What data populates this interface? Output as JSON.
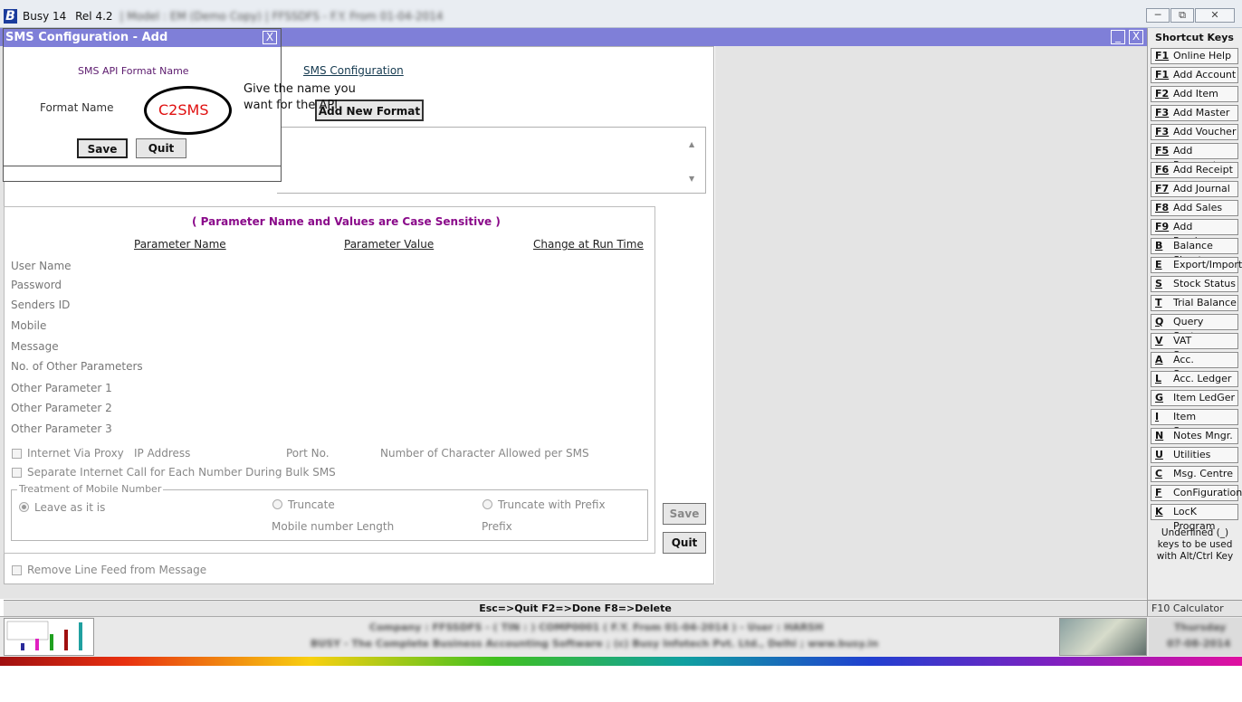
{
  "titlebar": {
    "logo": "B",
    "app_name": "Busy 14",
    "release": "Rel 4.2",
    "model_info": "| Model : EM (Demo Copy) | FFSSDFS - F.Y. From 01-04-2014"
  },
  "window_buttons": {
    "minimize": "─",
    "restore": "⧉",
    "close": "✕"
  },
  "mdi_buttons": {
    "minimize": "_",
    "close": "X"
  },
  "main": {
    "title": "SMS Configuration",
    "add_new_format_label": "Add New Format",
    "case_note": "( Parameter Name and Values are Case Sensitive )",
    "columns": [
      "Parameter Name",
      "Parameter Value",
      "Change at Run Time"
    ],
    "parameters": [
      "User Name",
      "Password",
      "Senders ID",
      "Mobile",
      "Message",
      "No. of Other Parameters",
      "Other Parameter 1",
      "Other Parameter 2",
      "Other Parameter 3"
    ],
    "internet_via_proxy": "Internet Via Proxy",
    "ip_address": "IP Address",
    "port_no": "Port No.",
    "chars_per_sms": "Number of Character Allowed per SMS",
    "separate_call": "Separate Internet Call for Each Number During Bulk SMS",
    "mobile_group_title": "Treatment of Mobile Number",
    "leave_as_is": "Leave as it is",
    "truncate": "Truncate",
    "truncate_with_prefix": "Truncate with Prefix",
    "mobile_number_length": "Mobile number Length",
    "prefix": "Prefix",
    "remove_line_feed": "Remove Line Feed from Message",
    "save_label": "Save",
    "quit_label": "Quit"
  },
  "dialog": {
    "title": "SMS Configuration - Add",
    "close": "X",
    "api_format_label": "SMS API Format Name",
    "format_name_label": "Format Name",
    "format_name_value": "C2SMS",
    "save_label": "Save",
    "quit_label": "Quit"
  },
  "annotation": {
    "hint_line1": "Give the name you",
    "hint_line2": "want for the API"
  },
  "shortcuts": {
    "title": "Shortcut Keys",
    "items": [
      {
        "key": "F1",
        "label": "Online Help"
      },
      {
        "key": "F1",
        "label": "Add Account"
      },
      {
        "key": "F2",
        "label": "Add Item"
      },
      {
        "key": "F3",
        "label": "Add Master"
      },
      {
        "key": "F3",
        "label": "Add Voucher"
      },
      {
        "key": "F5",
        "label": "Add Payment"
      },
      {
        "key": "F6",
        "label": "Add Receipt"
      },
      {
        "key": "F7",
        "label": "Add Journal"
      },
      {
        "key": "F8",
        "label": "Add Sales"
      },
      {
        "key": "F9",
        "label": "Add Purchase"
      },
      {
        "key": "B",
        "label": "Balance Sheet"
      },
      {
        "key": "E",
        "label": "Export/Import"
      },
      {
        "key": "S",
        "label": "Stock Status"
      },
      {
        "key": "T",
        "label": "Trial Balance"
      },
      {
        "key": "Q",
        "label": "Query System"
      },
      {
        "key": "V",
        "label": "VAT Summary"
      },
      {
        "key": "A",
        "label": "Acc. Summary"
      },
      {
        "key": "L",
        "label": "Acc. Ledger"
      },
      {
        "key": "G",
        "label": "Item LedGer"
      },
      {
        "key": "I",
        "label": "Item Summary"
      },
      {
        "key": "N",
        "label": "Notes Mngr."
      },
      {
        "key": "U",
        "label": "Utilities"
      },
      {
        "key": "C",
        "label": "Msg. Centre"
      },
      {
        "key": "F",
        "label": "ConFiguration"
      },
      {
        "key": "K",
        "label": "LocK Program"
      }
    ],
    "note": "Underlined (_) keys to be used with Alt/Ctrl Key"
  },
  "hotkeys": "Esc=>Quit   F2=>Done   F8=>Delete",
  "calculator": "F10 Calculator",
  "status": {
    "line1": "Company : FFSSDFS - ( TIN : ) COMP0001 ( F.Y. From 01-04-2014 ) - User : HARSH",
    "line2": "BUSY - The Complete Business Accounting Software  ;  (c) Busy Infotech Pvt. Ltd., Delhi  ;  www.busy.in",
    "day": "Thursday",
    "date": "07-08-2014"
  }
}
